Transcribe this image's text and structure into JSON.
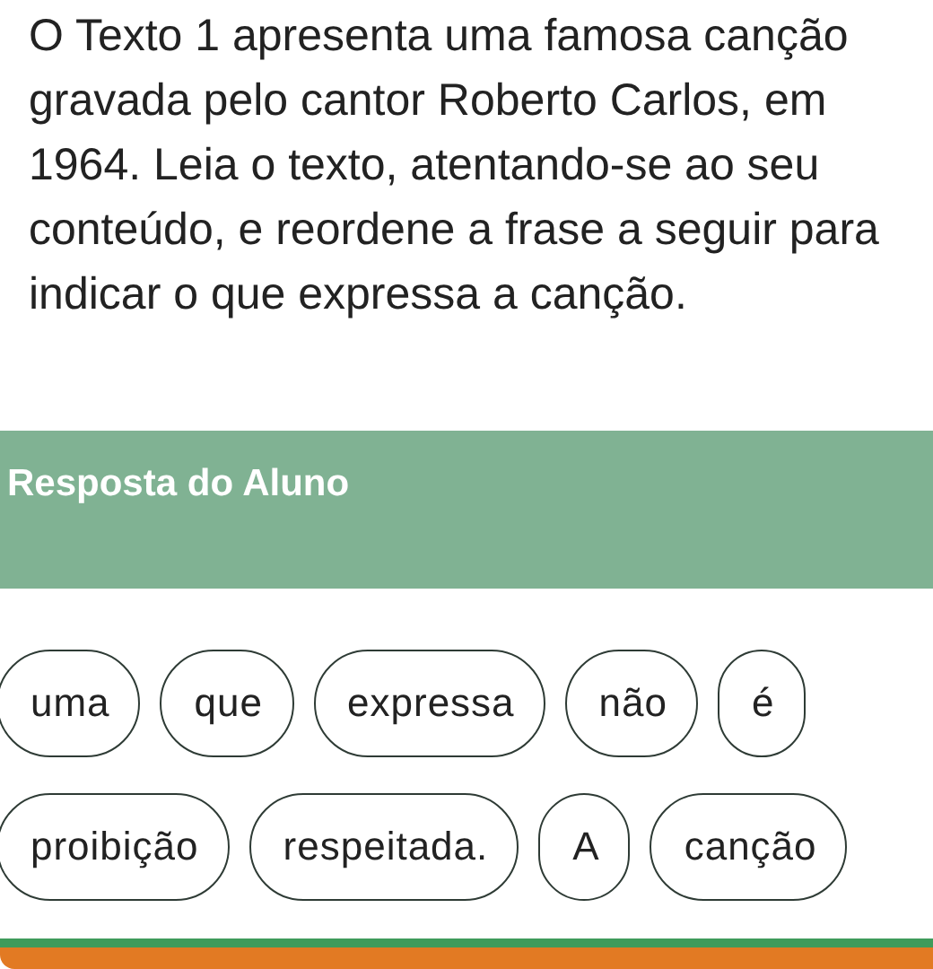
{
  "question": {
    "text": "O Texto 1 apresenta uma famosa canção gravada pelo cantor Roberto Carlos, em 1964. Leia o texto, atentando-se ao seu conteúdo, e reordene a frase a seguir para indicar o que expressa a canção."
  },
  "answer_header": {
    "title": "Resposta do Aluno"
  },
  "word_chips": [
    {
      "label": "uma"
    },
    {
      "label": "que"
    },
    {
      "label": "expressa"
    },
    {
      "label": "não"
    },
    {
      "label": "é"
    },
    {
      "label": "proibição"
    },
    {
      "label": "respeitada."
    },
    {
      "label": "A"
    },
    {
      "label": "canção"
    }
  ]
}
